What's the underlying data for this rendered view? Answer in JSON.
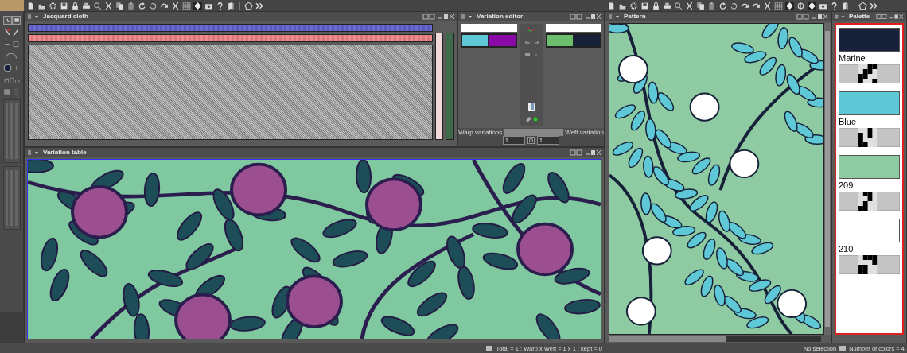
{
  "jacquard_cloth": {
    "title": "Jacquard cloth"
  },
  "variation_editor": {
    "title": "Variation editor",
    "warp_label": "Warp variations",
    "weft_label": "Weft variation",
    "warp_count": "1",
    "weft_count": "1"
  },
  "variation_table": {
    "title": "Variation table"
  },
  "pattern": {
    "title": "Pattern"
  },
  "palette": {
    "title": "Palette",
    "colors": [
      {
        "name": "Marine",
        "color": "#17213a"
      },
      {
        "name": "Blue",
        "color": "#5ec8d6"
      },
      {
        "name": "209",
        "color": "#8ecba3"
      },
      {
        "name": "210",
        "color": "#ffffff"
      }
    ]
  },
  "status_bar": {
    "summary": "Total = 1 : Warp x Weft = 1 x 1 : kept = 0",
    "selection": "No selection",
    "color_count": "Number of colors = 4"
  }
}
